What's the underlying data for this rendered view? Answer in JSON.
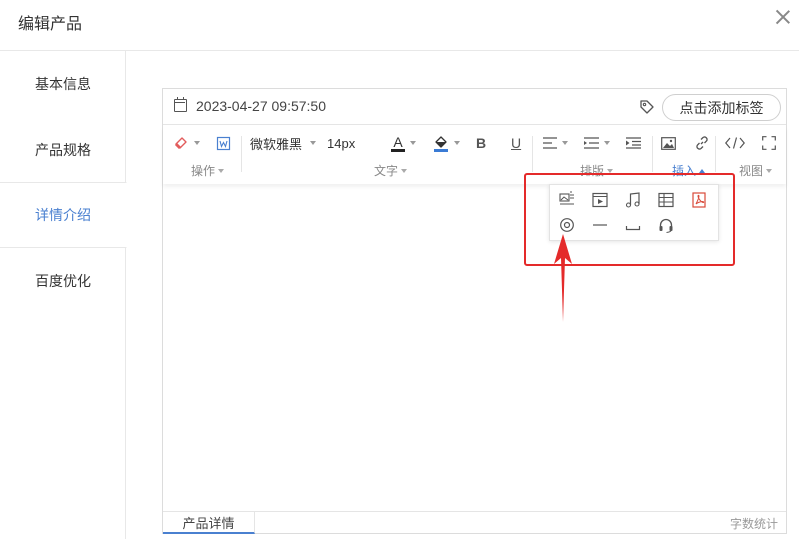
{
  "dialog": {
    "title": "编辑产品"
  },
  "sidebar": {
    "items": [
      {
        "label": "基本信息"
      },
      {
        "label": "产品规格"
      },
      {
        "label": "详情介绍",
        "active": true
      },
      {
        "label": "百度优化"
      }
    ]
  },
  "editor": {
    "datetime": "2023-04-27 09:57:50",
    "tag_button": "点击添加标签",
    "toolbar": {
      "font_family": "微软雅黑",
      "font_size": "14px",
      "groups": {
        "operate": "操作",
        "text": "文字",
        "layout": "排版",
        "insert": "插入",
        "view": "视图"
      },
      "bold": "B",
      "underline": "U",
      "font_color": "A"
    },
    "insert_menu": {
      "icons": [
        "image-text-icon",
        "video-icon",
        "music-icon",
        "table-icon",
        "pdf-icon",
        "location-icon",
        "horizontal-line-icon",
        "space-icon",
        "headset-icon"
      ]
    },
    "bottom": {
      "tab": "产品详情",
      "word_count": "字数统计"
    }
  },
  "colors": {
    "accent": "#4a80d0",
    "highlight": "#e42a2a",
    "font_color_bar": "#222222",
    "fill_color_bar": "#3a7bd5"
  }
}
